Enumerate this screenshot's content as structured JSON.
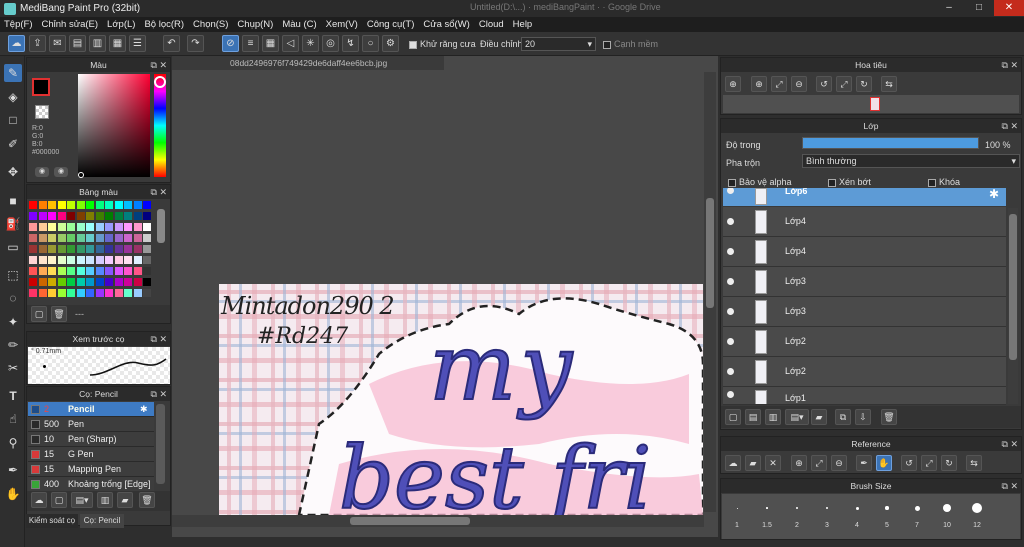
{
  "window": {
    "title": "MediBang Paint Pro (32bit)",
    "bg_tabs": "Untitled(D:\\...)  ·  mediBangPaint ·  ·  Google Drive",
    "controls": [
      "–",
      "□",
      "✕"
    ]
  },
  "menu": [
    "Tệp(F)",
    "Chỉnh sửa(E)",
    "Lớp(L)",
    "Bộ lọc(R)",
    "Chọn(S)",
    "Chụp(N)",
    "Màu (C)",
    "Xem(V)",
    "Công cụ(T)",
    "Cửa sổ(W)",
    "Cloud",
    "Help"
  ],
  "toolbar": {
    "antialias_label": "Khử răng cưa",
    "adjust_label": "Điều chỉnh",
    "adjust_value": "20",
    "edge_label": "Cạnh mềm"
  },
  "color_panel": {
    "title": "Màu",
    "rgb": [
      "R:0",
      "G:0",
      "B:0",
      "#000000"
    ],
    "accent": "#3b73b5"
  },
  "palette_panel": {
    "title": "Bảng màu",
    "footer": "---"
  },
  "brush_preview_panel": {
    "title": "Xem trước cọ",
    "size": "0.71mm"
  },
  "brush_panel": {
    "title": "Cọ: Pencil",
    "items": [
      {
        "size": "2",
        "name": "Pencil",
        "color": "#c23a3a",
        "selected": true
      },
      {
        "size": "500",
        "name": "Pen",
        "color": "#2a2a2a",
        "selected": false
      },
      {
        "size": "10",
        "name": "Pen (Sharp)",
        "color": "#2a2a2a",
        "selected": false
      },
      {
        "size": "15",
        "name": "G Pen",
        "color": "#d83a3a",
        "selected": false
      },
      {
        "size": "15",
        "name": "Mapping Pen",
        "color": "#d83a3a",
        "selected": false
      },
      {
        "size": "400",
        "name": "Khoảng trống [Edge]",
        "color": "#38a538",
        "selected": false
      }
    ],
    "tabs": [
      "Kiểm soát cọ",
      "Cọ: Pencil"
    ]
  },
  "document": {
    "tab": "08dd2496976f749429de6daff4ee6bcb.jpg",
    "handwriting_line1": "Mintadon290 2",
    "handwriting_line2": "#Rd247",
    "art_word1": "my",
    "art_word2": "best fri"
  },
  "navigator_panel": {
    "title": "Hoa tiêu"
  },
  "layer_panel": {
    "title": "Lớp",
    "opacity_label": "Độ trong",
    "opacity_value": "100 %",
    "opacity_fraction": 1.0,
    "blend_label": "Pha trộn",
    "blend_value": "Bình thường",
    "protect_alpha": "Bảo vệ alpha",
    "clipping": "Xén bớt",
    "lock": "Khóa",
    "layers": [
      "Lớp6",
      "Lớp4",
      "Lớp4",
      "Lớp3",
      "Lớp3",
      "Lớp2",
      "Lớp2",
      "Lớp1"
    ]
  },
  "reference_panel": {
    "title": "Reference"
  },
  "brush_size_panel": {
    "title": "Brush Size",
    "sizes": [
      "1",
      "1.5",
      "2",
      "3",
      "4",
      "5",
      "7",
      "10",
      "12"
    ]
  }
}
